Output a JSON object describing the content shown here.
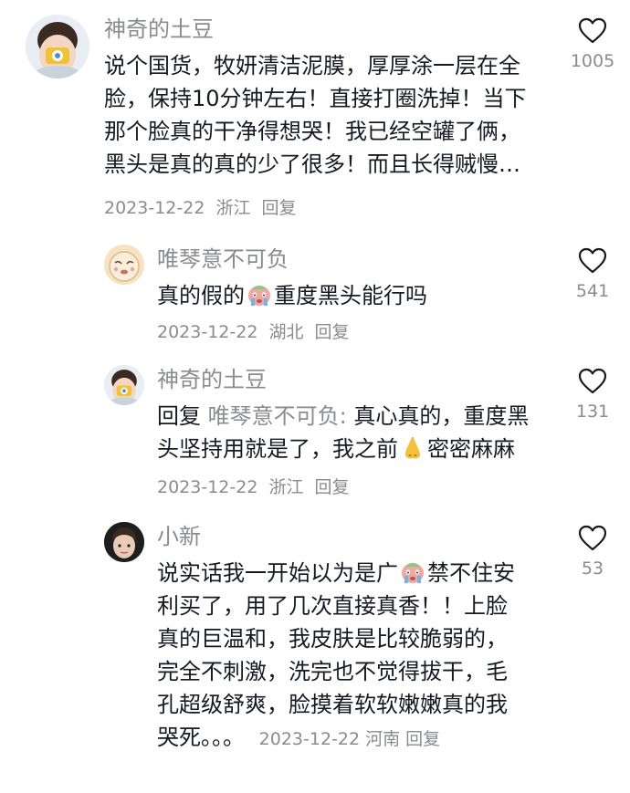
{
  "colors": {
    "text": "#161823",
    "secondary": "#8a8b91",
    "background": "#ffffff"
  },
  "comments": [
    {
      "author": "神奇的土豆",
      "lines": [
        "说个国货，牧妍清洁泥膜，厚厚涂一层在全",
        "脸，保持10分钟左右！直接打圈洗掉！当下",
        "那个脸真的干净得想哭！我已经空罐了俩，",
        "黑头是真的真的少了很多！而且长得贼慢…"
      ],
      "date": "2023-12-22",
      "location": "浙江",
      "reply_label": "回复",
      "likes": "1005"
    },
    {
      "author": "唯琴意不可负",
      "text_before": "真的假的",
      "emoji": "crying-face-emoji",
      "text_after": "重度黑头能行吗",
      "date": "2023-12-22",
      "location": "湖北",
      "reply_label": "回复",
      "likes": "541"
    },
    {
      "author": "神奇的土豆",
      "reply_prefix": "回复",
      "mention": "唯琴意不可负:",
      "line1_rest": "真心真的，重度黑",
      "line2_before": "头坚持用就是了，我之前",
      "line2_emoji": "nose-emoji",
      "line2_after": "密密麻麻",
      "date": "2023-12-22",
      "location": "浙江",
      "reply_label": "回复",
      "likes": "131"
    },
    {
      "author": "小新",
      "line1_before": "说实话我一开始以为是广",
      "line1_emoji": "crying-face-emoji",
      "line1_after": "禁不住安",
      "lines": [
        "利买了，用了几次直接真香！！上脸",
        "真的巨温和，我皮肤是比较脆弱的，",
        "完全不刺激，洗完也不觉得拔干，毛",
        "孔超级舒爽，脸摸着软软嫩嫩真的我"
      ],
      "last_line": "哭死。。。",
      "date": "2023-12-22",
      "location": "河南",
      "reply_label": "回复",
      "likes": "53"
    }
  ]
}
